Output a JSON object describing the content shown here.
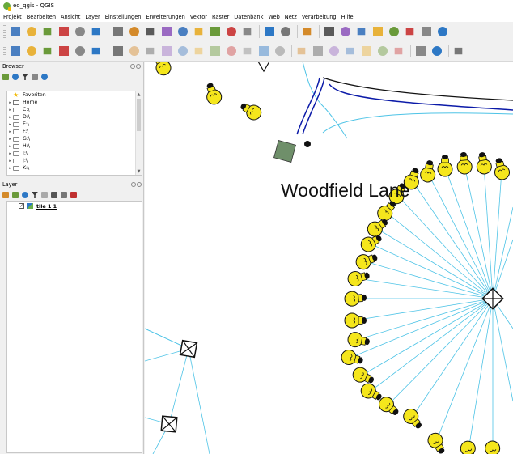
{
  "window": {
    "title": "eo_qgis - QGIS"
  },
  "menu": [
    "Projekt",
    "Bearbeiten",
    "Ansicht",
    "Layer",
    "Einstellungen",
    "Erweiterungen",
    "Vektor",
    "Raster",
    "Datenbank",
    "Web",
    "Netz",
    "Verarbeitung",
    "Hilfe"
  ],
  "toolbar1": [
    "new-project-icon",
    "open-project-icon",
    "save-project-icon",
    "save-as-icon",
    "print-layout-icon",
    "style-manager-icon",
    "pan-icon",
    "pan-selection-icon",
    "zoom-in-icon",
    "zoom-out-icon",
    "zoom-full-icon",
    "zoom-layer-icon",
    "zoom-selection-icon",
    "zoom-last-icon",
    "zoom-next-icon",
    "new-bookmark-icon",
    "show-bookmarks-icon",
    "refresh-icon",
    "identify-icon",
    "select-icon",
    "deselect-icon",
    "field-calc-icon",
    "attribute-table-icon",
    "statistics-icon",
    "sum-icon",
    "measure-icon"
  ],
  "toolbar2": [
    "data-source-icon",
    "add-vector-icon",
    "add-raster-icon",
    "add-mesh-icon",
    "add-delimited-icon",
    "add-virtual-icon",
    "edit-pencil-icon",
    "digitize-icon",
    "save-edits-icon",
    "add-feature-icon",
    "vertex-tool-icon",
    "delete-icon",
    "cut-icon",
    "copy-icon",
    "paste-icon",
    "undo-icon",
    "redo-icon",
    "label-icon",
    "label-pin-icon",
    "label-highlight-icon",
    "label-move-icon",
    "label-rotate-icon",
    "label-change-icon",
    "label-show-icon",
    "python-icon",
    "plugin-icon",
    "help-icon"
  ],
  "browser": {
    "title": "Browser",
    "items": [
      {
        "label": "Favoriten",
        "icon": "star-icon"
      },
      {
        "label": "Home",
        "icon": "home-icon"
      },
      {
        "label": "C:\\",
        "icon": "drive-icon"
      },
      {
        "label": "D:\\",
        "icon": "drive-icon"
      },
      {
        "label": "E:\\",
        "icon": "drive-icon"
      },
      {
        "label": "F:\\",
        "icon": "drive-icon"
      },
      {
        "label": "G:\\",
        "icon": "drive-icon"
      },
      {
        "label": "H:\\",
        "icon": "drive-icon"
      },
      {
        "label": "I:\\",
        "icon": "drive-icon"
      },
      {
        "label": "J:\\",
        "icon": "drive-icon"
      },
      {
        "label": "K:\\",
        "icon": "drive-icon"
      }
    ]
  },
  "layers": {
    "title": "Layer",
    "items": [
      {
        "label": "tile 1 1",
        "checked": "✓"
      }
    ]
  },
  "map": {
    "label": "Woodfield Lane"
  },
  "colors": {
    "bulb": "#f5e61c",
    "line": "#4dc3e6",
    "road": "#0b1aa8",
    "building": "#6f8f6a"
  }
}
